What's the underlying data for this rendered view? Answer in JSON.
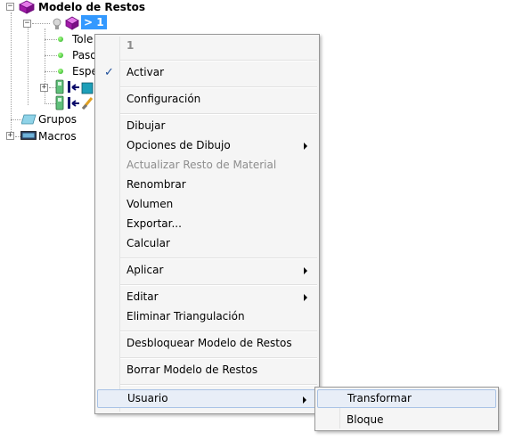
{
  "tree": {
    "root_label": "Modelo de Restos",
    "selected_label": "> 1",
    "child_labels": [
      "Tole",
      "Paso",
      "Espe"
    ],
    "grupos_label": "Grupos",
    "macros_label": "Macros",
    "expander_collapsed": "+",
    "expander_expanded": "−"
  },
  "menu": {
    "header": "1",
    "check_glyph": "✓",
    "items": {
      "activar": "Activar",
      "configuracion": "Configuración",
      "dibujar": "Dibujar",
      "opciones_dibujo": "Opciones de Dibujo",
      "actualizar_resto": "Actualizar Resto de Material",
      "renombrar": "Renombrar",
      "volumen": "Volumen",
      "exportar": "Exportar...",
      "calcular": "Calcular",
      "aplicar": "Aplicar",
      "editar": "Editar",
      "eliminar_triangulacion": "Eliminar Triangulación",
      "desbloquear": "Desbloquear Modelo de Restos",
      "borrar": "Borrar Modelo de Restos",
      "usuario": "Usuario"
    }
  },
  "submenu": {
    "transformar": "Transformar",
    "bloque": "Bloque"
  },
  "colors": {
    "selection": "#3399ff",
    "menu_bg": "#f5f5f5",
    "hover_bg": "#e8eef7",
    "disabled_text": "#8d8d8d"
  }
}
